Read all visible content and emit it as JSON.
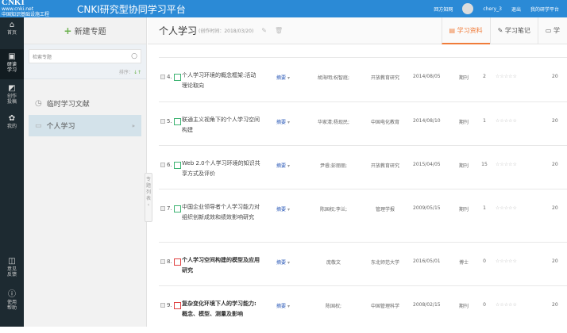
{
  "header": {
    "logo_text": "CNKI",
    "logo_sub1": "www.cnki.net",
    "logo_sub2": "中国知识基础设施工程",
    "app_title": "CNKI研究型协同学习平台",
    "links": [
      "回方知网",
      "chery_3",
      "退出",
      "我的研学平台"
    ]
  },
  "nav": {
    "items": [
      {
        "icon": "home-icon",
        "label": "首页"
      },
      {
        "icon": "study-icon",
        "label": "研读学习"
      },
      {
        "icon": "write-icon",
        "label": "创作投稿"
      },
      {
        "icon": "mine-icon",
        "label": "我的"
      },
      {
        "icon": "feedback-icon",
        "label": "意见反馈"
      },
      {
        "icon": "help-icon",
        "label": "使用帮助"
      }
    ]
  },
  "panel": {
    "new_label": "新建专题",
    "search_placeholder": "检索专题",
    "sort_label": "排序：",
    "sort_icon": "↓↑",
    "items": [
      {
        "label": "临时学习文献"
      },
      {
        "label": "个人学习"
      }
    ],
    "toggle_label": "专题列表"
  },
  "main": {
    "title": "个人学习",
    "created": "(创作时间：2018/03/20)",
    "tabs": [
      {
        "label": "学习资料"
      },
      {
        "label": "学习笔记"
      },
      {
        "label": "学"
      }
    ]
  },
  "rows": [
    {
      "num": "4.",
      "type_icon": "html",
      "title": "个人学习环境的概念框架:活动理论取向",
      "abstract": "摘要",
      "author": "胡海明;祝智庭;",
      "journal": "开放教育研究",
      "date": "2014/08/05",
      "type": "期刊",
      "count": "2",
      "stars": "☆☆☆☆☆",
      "year": "20"
    },
    {
      "num": "5.",
      "type_icon": "html",
      "title": "联通主义视角下的个人学习空间构建",
      "abstract": "摘要",
      "author": "华家清;杨现民;",
      "journal": "中国电化教育",
      "date": "2014/08/10",
      "type": "期刊",
      "count": "1",
      "stars": "☆☆☆☆☆",
      "year": "20"
    },
    {
      "num": "6.",
      "type_icon": "html",
      "title": "Web 2.0个人学习环境的知识共享方式及评价",
      "abstract": "摘要",
      "author": "尹睿;彭丽丽;",
      "journal": "开放教育研究",
      "date": "2015/04/05",
      "type": "期刊",
      "count": "15",
      "stars": "☆☆☆☆☆",
      "year": "20"
    },
    {
      "num": "7.",
      "type_icon": "html",
      "title": "中国企业领导者个人学习能力对组织创新成效和绩效影响研究",
      "abstract": "摘要",
      "author": "陈国权;李兰;",
      "journal": "管理学报",
      "date": "2009/05/15",
      "type": "期刊",
      "count": "1",
      "stars": "☆☆☆☆☆",
      "year": "20"
    },
    {
      "num": "8.",
      "type_icon": "pdf",
      "title": "个人学习空间构建的模型及应用研究",
      "abstract": "摘要",
      "author": "庞敬文",
      "journal": "东北师范大学",
      "date": "2016/05/01",
      "type": "博士",
      "count": "0",
      "stars": "☆☆☆☆☆",
      "year": "20"
    },
    {
      "num": "9.",
      "type_icon": "pdf",
      "title": "复杂变化环境下人的学习能力:概念、模型、测量及影响",
      "abstract": "摘要",
      "author": "陈国权;",
      "journal": "中国管理科学",
      "date": "2008/02/15",
      "type": "期刊",
      "count": "0",
      "stars": "☆☆☆☆☆",
      "year": "20"
    }
  ]
}
